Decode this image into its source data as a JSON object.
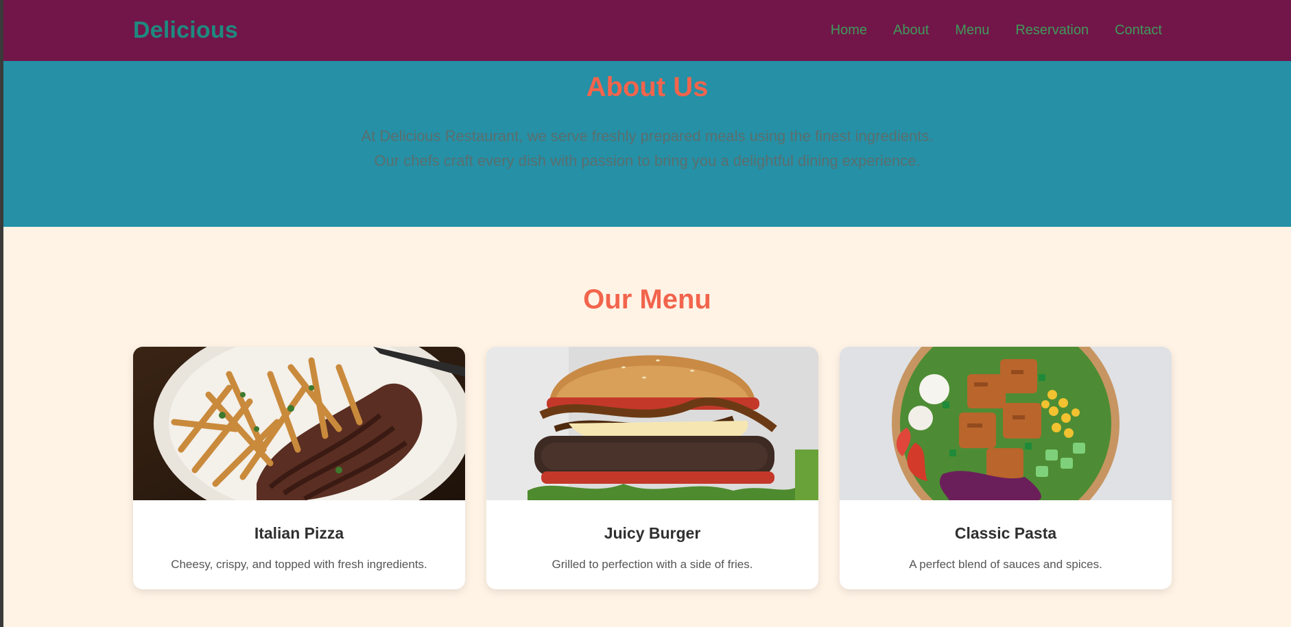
{
  "header": {
    "logo": "Delicious",
    "nav": [
      "Home",
      "About",
      "Menu",
      "Reservation",
      "Contact"
    ]
  },
  "about": {
    "title": "About Us",
    "lines": [
      "At Delicious Restaurant, we serve freshly prepared meals using the finest ingredients.",
      "Our chefs craft every dish with passion to bring you a delightful dining experience."
    ]
  },
  "menu": {
    "title": "Our Menu",
    "items": [
      {
        "title": "Italian Pizza",
        "description": "Cheesy, crispy, and topped with fresh ingredients.",
        "image_icon": "steak-fries-photo-icon"
      },
      {
        "title": "Juicy Burger",
        "description": "Grilled to perfection with a side of fries.",
        "image_icon": "burger-photo-icon"
      },
      {
        "title": "Classic Pasta",
        "description": "A perfect blend of sauces and spices.",
        "image_icon": "salad-bowl-photo-icon"
      }
    ]
  },
  "colors": {
    "navbar_bg": "#721649",
    "logo": "#1E8A80",
    "nav_link": "#3E9B5A",
    "about_bg": "#2590A6",
    "heading_accent": "#F2644C",
    "page_bg": "#FFF3E6"
  }
}
